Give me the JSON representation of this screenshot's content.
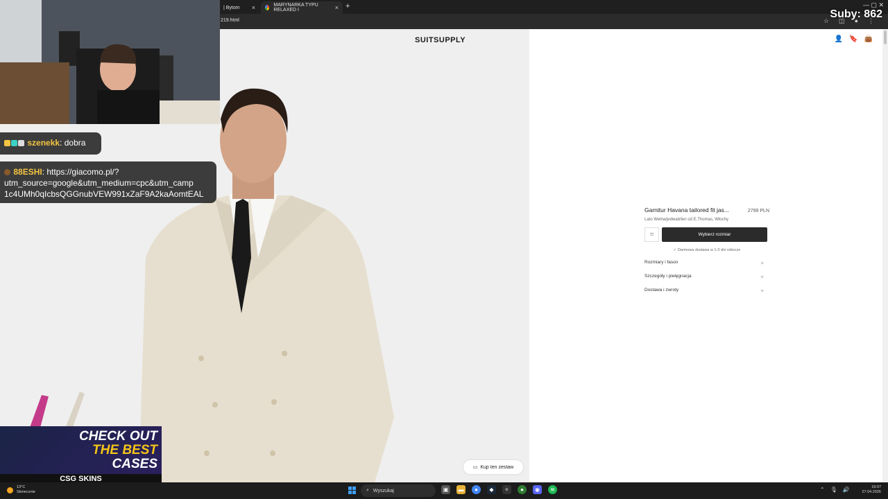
{
  "browser": {
    "tabs": [
      {
        "title": "| Bytom",
        "active": false
      },
      {
        "title": "MARYNARKA TYPU RELAXED I",
        "active": true
      }
    ],
    "url": "219.html"
  },
  "site": {
    "brand": "SUITSUPPLY",
    "shop_set_label": "Kup ten zestaw"
  },
  "product": {
    "name": "Garnitur Havana tailored fit jas...",
    "price": "2799 PLN",
    "subtitle": "Lato Wełna/jedwab/len od E.Thomas, Włochy",
    "select_size_label": "Wybierz rozmiar",
    "delivery": "Darmowa dostawa w 1-3 dni robocze",
    "accordion": [
      "Rozmiary i fason",
      "Szczegóły i pielęgnacja",
      "Dostawa i zwroty"
    ]
  },
  "overlay": {
    "subs": "Suby: 862",
    "chat": [
      {
        "user": "szenekk",
        "message": "dobra"
      },
      {
        "user": "88ESHI",
        "message": "https://giacomo.pl/?utm_source=google&utm_medium=cpc&utm_camp 1c4UMh0qIcbsQGGnubVEW991xZaF9A2kaAomtEAL"
      }
    ],
    "ad": {
      "line1": "CHECK OUT",
      "line2": "THE BEST",
      "line3": "CASES",
      "logo": "CSG SKINS"
    }
  },
  "taskbar": {
    "weather_temp": "13°C",
    "weather_desc": "Słonecznie",
    "search_placeholder": "Wyszukaj",
    "time": "19:07",
    "date": "27.04.2026"
  }
}
